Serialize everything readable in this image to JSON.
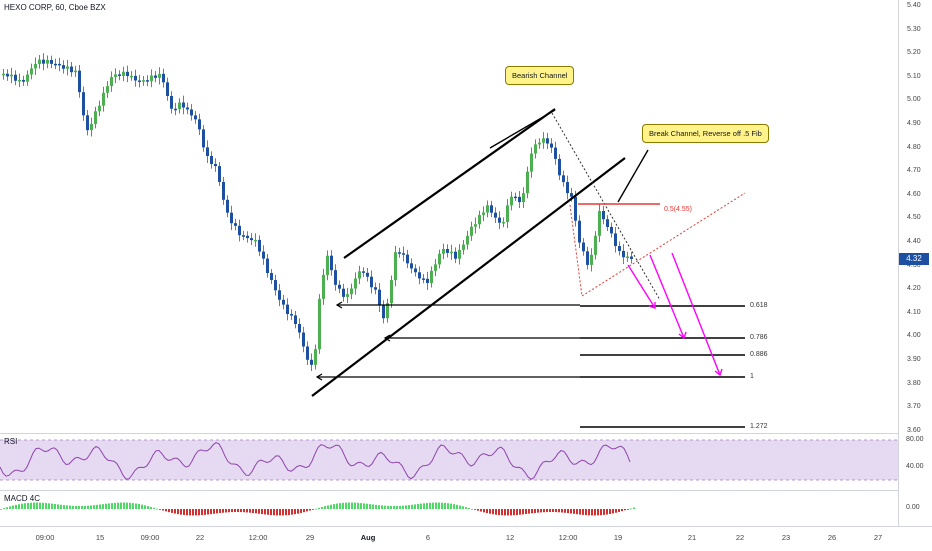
{
  "chart": {
    "title": "HEXO CORP, 60, Cboe BZX",
    "current_price": "4.32",
    "price_axis": [
      "5.40",
      "5.30",
      "5.20",
      "5.10",
      "5.00",
      "4.90",
      "4.80",
      "4.70",
      "4.60",
      "4.50",
      "4.40",
      "4.30",
      "4.20",
      "4.10",
      "4.00",
      "3.90",
      "3.80",
      "3.70",
      "3.60"
    ],
    "time_axis": [
      "09:00",
      "15",
      "09:00",
      "22",
      "12:00",
      "29",
      "Aug",
      "6",
      "12",
      "12:00",
      "19",
      "21",
      "22",
      "23",
      "26",
      "27"
    ],
    "annotations": {
      "bearish_channel": "Bearish Channel",
      "break_channel": "Break Channel, Reverse off .5 Fib",
      "fib_05": "0.5(4.55)"
    },
    "fib_levels": [
      "0.618",
      "0.786",
      "0.886",
      "1",
      "1.272"
    ],
    "colors": {
      "up": "#4caf50",
      "down": "#1e50a2",
      "callout": "#fff38a",
      "arrows": "#ff00ff",
      "fib_05": "#e53935"
    }
  },
  "rsi": {
    "label": "RSI",
    "levels": [
      "80.00",
      "40.00"
    ]
  },
  "macd": {
    "label": "MACD 4C",
    "level": "0.00"
  },
  "chart_data": {
    "type": "candlestick",
    "title": "HEXO CORP, 60, Cboe BZX",
    "ylim": [
      3.6,
      5.4
    ],
    "last": 4.32,
    "fib_levels": [
      {
        "label": "0.5(4.55)",
        "value": 4.55
      },
      {
        "label": "0.618",
        "value": 4.12
      },
      {
        "label": "0.786",
        "value": 3.98
      },
      {
        "label": "0.886",
        "value": 3.9
      },
      {
        "label": "1",
        "value": 3.81
      },
      {
        "label": "1.272",
        "value": 3.62
      }
    ]
  }
}
